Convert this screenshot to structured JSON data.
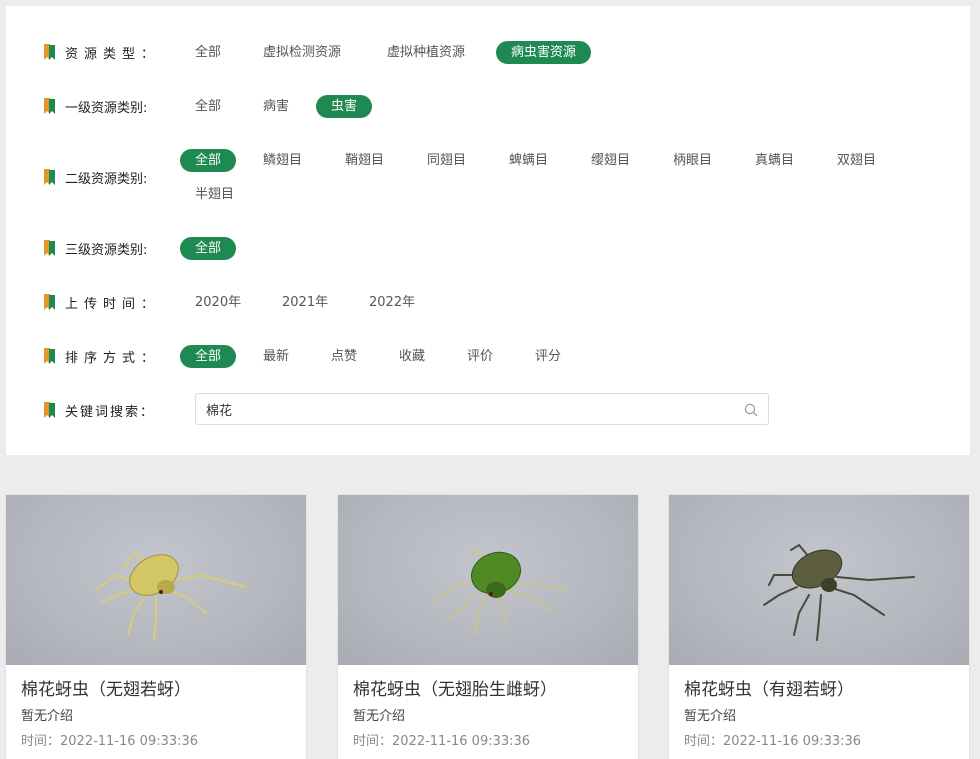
{
  "filters": {
    "resource_type": {
      "label": "资源类型：",
      "options": [
        "全部",
        "虚拟检测资源",
        "虚拟种植资源",
        "病虫害资源"
      ],
      "selected": "病虫害资源"
    },
    "level1": {
      "label": "一级资源类别:",
      "options": [
        "全部",
        "病害",
        "虫害"
      ],
      "selected": "虫害"
    },
    "level2": {
      "label": "二级资源类别:",
      "options": [
        "全部",
        "鳞翅目",
        "鞘翅目",
        "同翅目",
        "蜱螨目",
        "缨翅目",
        "柄眼目",
        "真螨目",
        "双翅目",
        "半翅目"
      ],
      "selected": "全部"
    },
    "level3": {
      "label": "三级资源类别:",
      "options": [
        "全部"
      ],
      "selected": "全部"
    },
    "upload_time": {
      "label": "上传时间：",
      "options": [
        "2020年",
        "2021年",
        "2022年"
      ]
    },
    "sort": {
      "label": "排序方式：",
      "options": [
        "全部",
        "最新",
        "点赞",
        "收藏",
        "评价",
        "评分"
      ],
      "selected": "全部"
    },
    "keyword": {
      "label": "关键词搜索：",
      "value": "棉花"
    }
  },
  "cards": [
    {
      "title": "棉花蚜虫（无翅若蚜）",
      "desc": "暂无介绍",
      "time": "时间：2022-11-16 09:33:36",
      "bug_color": "#d4c765"
    },
    {
      "title": "棉花蚜虫（无翅胎生雌蚜）",
      "desc": "暂无介绍",
      "time": "时间：2022-11-16 09:33:36",
      "bug_color": "#4f8a25"
    },
    {
      "title": "棉花蚜虫（有翅若蚜）",
      "desc": "暂无介绍",
      "time": "时间：2022-11-16 09:33:36",
      "bug_color": "#5d5e40"
    }
  ],
  "colors": {
    "accent": "#1e8a52",
    "leaf_orange": "#e2962a",
    "leaf_green": "#1e8a52"
  },
  "icons": {
    "row_marker": "leaf-bookmark-icon",
    "search": "search-icon"
  }
}
